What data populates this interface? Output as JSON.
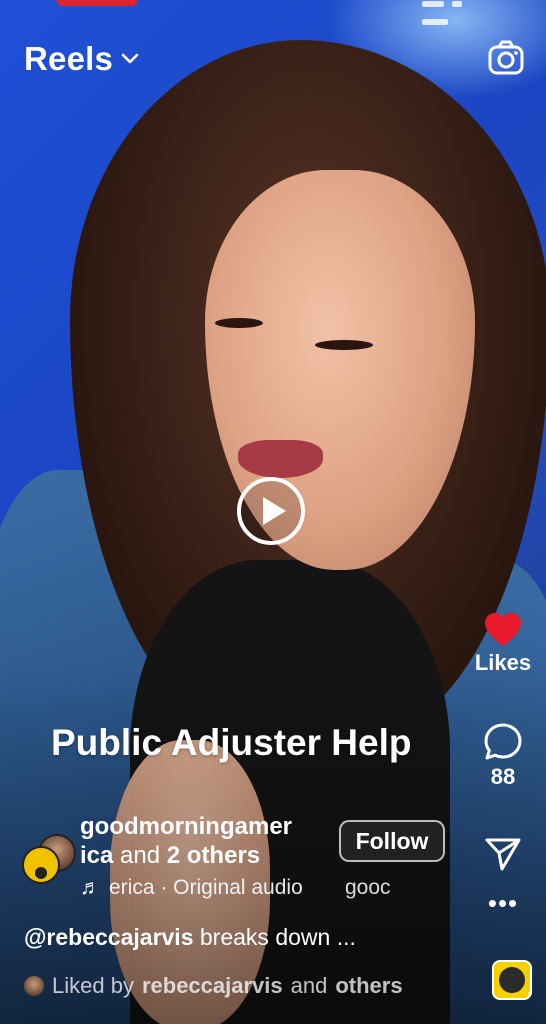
{
  "header": {
    "title": "Reels"
  },
  "overlay": {
    "title": "Public Adjuster Help"
  },
  "rail": {
    "likes_label": "Likes",
    "comments_count": "88"
  },
  "author": {
    "name_line1": "goodmorningamer",
    "name_line2": "ica",
    "and_text": "and",
    "others": "2 others",
    "follow_label": "Follow"
  },
  "audio": {
    "text": "erica · Original audio",
    "ticker": "gooc"
  },
  "caption": {
    "handle": "@rebeccajarvis",
    "text": "breaks down ..."
  },
  "liked": {
    "prefix": "Liked by",
    "user": "rebeccajarvis",
    "and_text": "and",
    "others": "others"
  },
  "colors": {
    "heart": "#e8192c",
    "brand_yellow": "#f4d200"
  },
  "icons": [
    "chevron-down-icon",
    "camera-icon",
    "play-icon",
    "heart-icon",
    "comment-icon",
    "share-icon",
    "more-icon",
    "music-note-icon"
  ]
}
